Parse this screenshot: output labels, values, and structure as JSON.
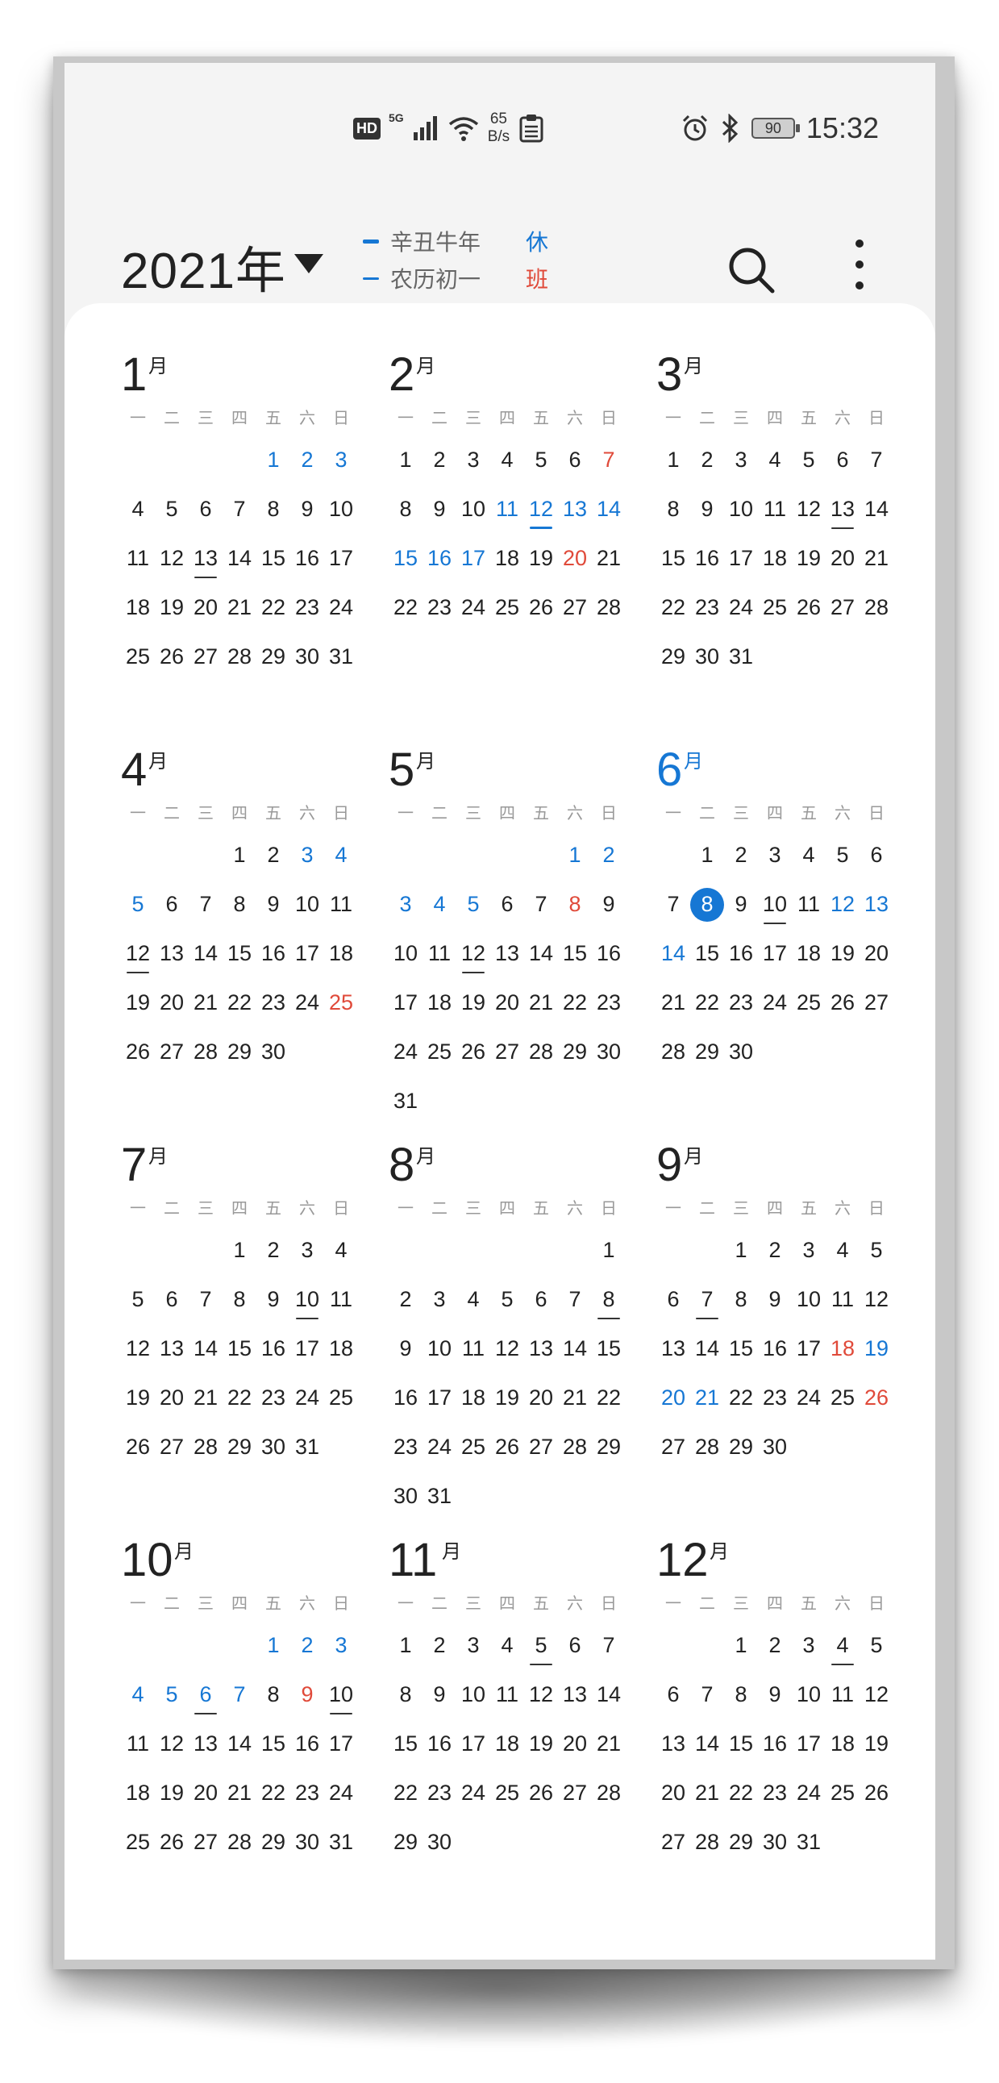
{
  "status_bar": {
    "hd": "HD",
    "network": "5G",
    "speed_value": "65",
    "speed_unit": "B/s",
    "battery": "90",
    "time": "15:32"
  },
  "header": {
    "year_title": "2021年",
    "legend": {
      "lunar_year": "辛丑牛年",
      "lunar_day": "农历初一",
      "rest_mark": "休",
      "work_mark": "班"
    }
  },
  "colors": {
    "accent": "#1677d4",
    "workday": "#e04a3a",
    "text": "#222222",
    "weekday": "#999999"
  },
  "weekday_labels": [
    "一",
    "二",
    "三",
    "四",
    "五",
    "六",
    "日"
  ],
  "month_suffix": "月",
  "today": {
    "month": 6,
    "day": 8
  },
  "months": [
    {
      "num": "1",
      "offset": 4,
      "days": 31,
      "holiday": [
        1,
        2,
        3
      ],
      "workday": [],
      "festival": [],
      "solar": [
        13
      ]
    },
    {
      "num": "2",
      "offset": 0,
      "days": 28,
      "holiday": [
        11,
        12,
        13,
        14,
        15,
        16,
        17
      ],
      "workday": [
        7,
        20
      ],
      "festival": [
        12
      ],
      "solar": []
    },
    {
      "num": "3",
      "offset": 0,
      "days": 31,
      "holiday": [],
      "workday": [],
      "festival": [],
      "solar": [
        13
      ]
    },
    {
      "num": "4",
      "offset": 3,
      "days": 30,
      "holiday": [
        3,
        4,
        5
      ],
      "workday": [
        25
      ],
      "festival": [],
      "solar": [
        12
      ]
    },
    {
      "num": "5",
      "offset": 5,
      "days": 31,
      "holiday": [
        1,
        2,
        3,
        4,
        5
      ],
      "workday": [
        8
      ],
      "festival": [],
      "solar": [
        12
      ]
    },
    {
      "num": "6",
      "offset": 1,
      "days": 30,
      "holiday": [
        12,
        13,
        14
      ],
      "workday": [],
      "festival": [],
      "solar": [
        10
      ]
    },
    {
      "num": "7",
      "offset": 3,
      "days": 31,
      "holiday": [],
      "workday": [],
      "festival": [],
      "solar": [
        10
      ]
    },
    {
      "num": "8",
      "offset": 6,
      "days": 31,
      "holiday": [],
      "workday": [],
      "festival": [],
      "solar": [
        8
      ]
    },
    {
      "num": "9",
      "offset": 2,
      "days": 30,
      "holiday": [
        19,
        20,
        21
      ],
      "workday": [
        18,
        26
      ],
      "festival": [],
      "solar": [
        7
      ]
    },
    {
      "num": "10",
      "offset": 4,
      "days": 31,
      "holiday": [
        1,
        2,
        3,
        4,
        5,
        6,
        7
      ],
      "workday": [
        9
      ],
      "festival": [],
      "solar": [
        6,
        10
      ]
    },
    {
      "num": "11",
      "offset": 0,
      "days": 30,
      "holiday": [],
      "workday": [],
      "festival": [],
      "solar": [
        5
      ]
    },
    {
      "num": "12",
      "offset": 2,
      "days": 31,
      "holiday": [],
      "workday": [],
      "festival": [],
      "solar": [
        4
      ]
    }
  ]
}
